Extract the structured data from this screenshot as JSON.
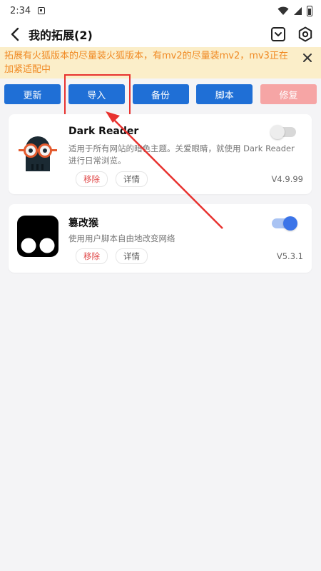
{
  "status_bar": {
    "time": "2:34"
  },
  "header": {
    "title": "我的拓展(2)"
  },
  "notice": {
    "text": "拓展有火狐版本的尽量装火狐版本，有mv2的尽量装mv2，mv3正在加紧适配中"
  },
  "actions": {
    "update": "更新",
    "import": "导入",
    "backup": "备份",
    "script": "脚本",
    "repair": "修复"
  },
  "extensions": [
    {
      "name": "Dark Reader",
      "description": "适用于所有网站的暗色主题。关爱眼睛，就使用 Dark Reader 进行日常浏览。",
      "remove_label": "移除",
      "detail_label": "详情",
      "version": "V4.9.99",
      "enabled": false
    },
    {
      "name": "篡改猴",
      "description": "使用用户脚本自由地改变网络",
      "remove_label": "移除",
      "detail_label": "详情",
      "version": "V5.3.1",
      "enabled": true
    }
  ],
  "colors": {
    "accent": "#1f6fd6",
    "notice_bg": "#fbeec9",
    "notice_text": "#f08a24",
    "annotation": "#e8322f",
    "disabled_button": "#f6a5a5",
    "toggle_on": "#3b74e8"
  },
  "icons": [
    "back-icon",
    "download-box-icon",
    "settings-gear-icon",
    "close-icon",
    "wifi-icon",
    "signal-icon",
    "battery-icon"
  ]
}
